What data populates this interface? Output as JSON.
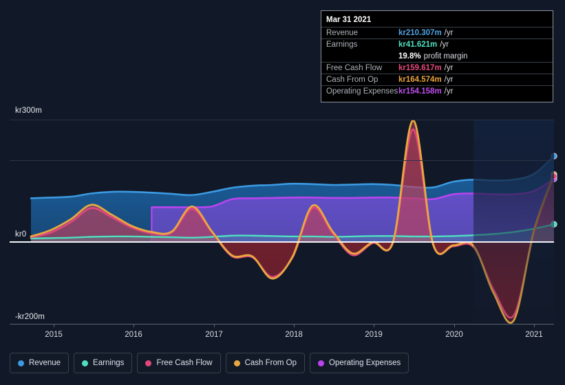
{
  "tooltip": {
    "date": "Mar 31 2021",
    "rows": [
      {
        "label": "Revenue",
        "value": "kr210.307m",
        "unit": "/yr",
        "color": "#4fa3e3"
      },
      {
        "label": "Earnings",
        "value": "kr41.621m",
        "unit": "/yr",
        "color": "#4fe0c0"
      },
      {
        "label": "",
        "value": "19.8%",
        "unit": "profit margin",
        "color": "#ffffff"
      },
      {
        "label": "Free Cash Flow",
        "value": "kr159.617m",
        "unit": "/yr",
        "color": "#e8497f"
      },
      {
        "label": "Cash From Op",
        "value": "kr164.574m",
        "unit": "/yr",
        "color": "#e8a33d"
      },
      {
        "label": "Operating Expenses",
        "value": "kr154.158m",
        "unit": "/yr",
        "color": "#c04ff0"
      }
    ]
  },
  "legend": [
    {
      "label": "Revenue",
      "color": "#3b9ae1"
    },
    {
      "label": "Earnings",
      "color": "#4fe0c0"
    },
    {
      "label": "Free Cash Flow",
      "color": "#e0477c"
    },
    {
      "label": "Cash From Op",
      "color": "#e9a93f"
    },
    {
      "label": "Operating Expenses",
      "color": "#bb44ef"
    }
  ],
  "axis": {
    "y_labels": [
      "kr300m",
      "kr0",
      "-kr200m"
    ],
    "x_labels": [
      "2015",
      "2016",
      "2017",
      "2018",
      "2019",
      "2020",
      "2021"
    ]
  },
  "chart_data": {
    "type": "area",
    "title": "",
    "xlabel": "",
    "ylabel": "",
    "currency": "kr",
    "unit": "m",
    "ylim": [
      -200,
      300
    ],
    "yticks": [
      300,
      150,
      0,
      -200
    ],
    "grid": true,
    "legend_position": "bottom",
    "x": [
      "2014.75",
      "2015",
      "2015.25",
      "2015.5",
      "2015.75",
      "2016",
      "2016.25",
      "2016.5",
      "2016.75",
      "2017",
      "2017.25",
      "2017.5",
      "2017.75",
      "2018",
      "2018.25",
      "2018.5",
      "2018.75",
      "2019",
      "2019.25",
      "2019.5",
      "2019.75",
      "2020",
      "2020.25",
      "2020.5",
      "2020.75",
      "2021",
      "2021.25"
    ],
    "series": [
      {
        "name": "Revenue",
        "color": "#3b9ae1",
        "values": [
          106,
          108,
          110,
          118,
          122,
          122,
          120,
          117,
          114,
          122,
          132,
          137,
          139,
          142,
          141,
          139,
          140,
          141,
          139,
          134,
          133,
          147,
          152,
          150,
          152,
          166,
          210
        ]
      },
      {
        "name": "Earnings",
        "color": "#4fe0c0",
        "values": [
          7,
          8,
          9,
          11,
          12,
          12,
          11,
          10,
          9,
          11,
          14,
          14,
          13,
          12,
          12,
          11,
          12,
          13,
          13,
          12,
          12,
          13,
          15,
          18,
          23,
          31,
          42
        ]
      },
      {
        "name": "Free Cash Flow",
        "color": "#e0477c",
        "values": [
          10,
          22,
          48,
          82,
          60,
          34,
          20,
          22,
          80,
          22,
          -37,
          -39,
          -88,
          -40,
          82,
          20,
          -34,
          -4,
          -3,
          276,
          -10,
          -12,
          -14,
          -120,
          -183,
          20,
          160
        ]
      },
      {
        "name": "Cash From Op",
        "color": "#e9a93f",
        "values": [
          12,
          28,
          55,
          90,
          66,
          38,
          23,
          24,
          86,
          24,
          -35,
          -37,
          -92,
          -38,
          88,
          24,
          -30,
          -2,
          -1,
          298,
          -8,
          -10,
          -11,
          -128,
          -195,
          26,
          165
        ]
      },
      {
        "name": "Operating Expenses",
        "color": "#bb44ef",
        "values": [
          null,
          null,
          null,
          null,
          null,
          null,
          84,
          84,
          84,
          86,
          104,
          106,
          107,
          108,
          108,
          107,
          107,
          108,
          108,
          106,
          104,
          116,
          118,
          116,
          116,
          124,
          154
        ]
      }
    ],
    "endpoints": [
      {
        "name": "Revenue",
        "color": "#3b9ae1",
        "y": 210
      },
      {
        "name": "Cash From Op",
        "color": "#e9a93f",
        "y": 165
      },
      {
        "name": "Operating Expenses",
        "color": "#bb44ef",
        "y": 154
      },
      {
        "name": "Free Cash Flow",
        "color": "#e0477c",
        "y": 160
      },
      {
        "name": "Earnings",
        "color": "#4fe0c0",
        "y": 42
      }
    ]
  }
}
